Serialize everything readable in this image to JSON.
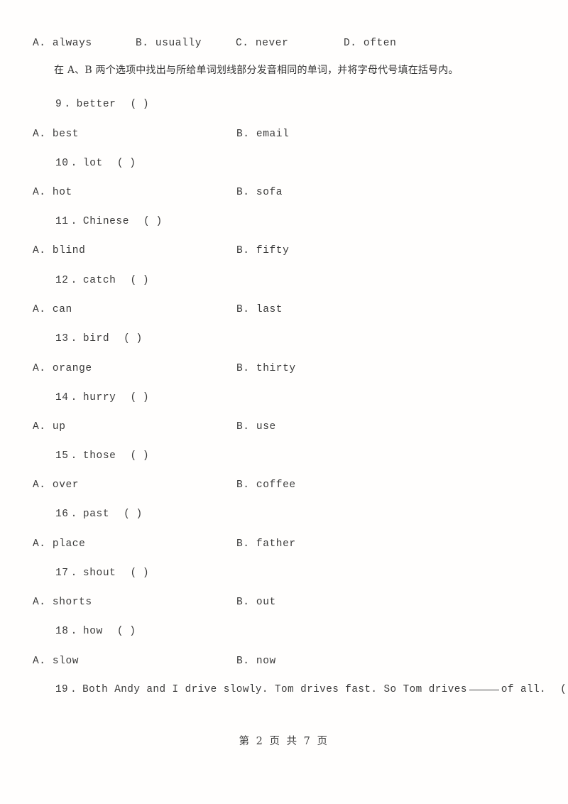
{
  "document": {
    "type": "scanned-exam-worksheet",
    "page_background": "#fffefd",
    "text_color": "#3a3a3a"
  },
  "top_options_row": {
    "a": "A. always",
    "b": "B. usually",
    "c": "C. never",
    "d": "D. often"
  },
  "instruction": {
    "text": "在 A、B 两个选项中找出与所给单词划线部分发音相同的单词，并将字母代号填在括号内。"
  },
  "questions": [
    {
      "number": "9",
      "dot": ".",
      "word": "better",
      "paren": "(      )",
      "option_a": "A. best",
      "option_b": "B. email"
    },
    {
      "number": "10",
      "dot": ".",
      "word": "lot",
      "paren": "(      )",
      "option_a": "A. hot",
      "option_b": "B. sofa"
    },
    {
      "number": "11",
      "dot": ".",
      "word": "Chinese",
      "paren": "(      )",
      "option_a": "A. blind",
      "option_b": "B. fifty"
    },
    {
      "number": "12",
      "dot": ".",
      "word": "catch",
      "paren": "(      )",
      "option_a": "A. can",
      "option_b": "B. last"
    },
    {
      "number": "13",
      "dot": ".",
      "word": "bird",
      "paren": "(      )",
      "option_a": "A. orange",
      "option_b": "B. thirty"
    },
    {
      "number": "14",
      "dot": ".",
      "word": "hurry",
      "paren": "(      )",
      "option_a": "A. up",
      "option_b": "B. use"
    },
    {
      "number": "15",
      "dot": ".",
      "word": "those",
      "paren": "(      )",
      "option_a": "A. over",
      "option_b": "B. coffee"
    },
    {
      "number": "16",
      "dot": ".",
      "word": "past",
      "paren": "(      )",
      "option_a": "A. place",
      "option_b": "B. father"
    },
    {
      "number": "17",
      "dot": ".",
      "word": "shout",
      "paren": "(      )",
      "option_a": "A. shorts",
      "option_b": "B. out"
    },
    {
      "number": "18",
      "dot": ".",
      "word": "how",
      "paren": "(      )",
      "option_a": "A. slow",
      "option_b": "B. now"
    }
  ],
  "question_19": {
    "number": "19",
    "dot": ".",
    "text_before_blank": "Both Andy and I drive slowly. Tom drives fast. So Tom drives",
    "text_after_blank": "of all.",
    "paren": "(      )"
  },
  "footer": {
    "text": "第 2 页 共 7 页"
  }
}
